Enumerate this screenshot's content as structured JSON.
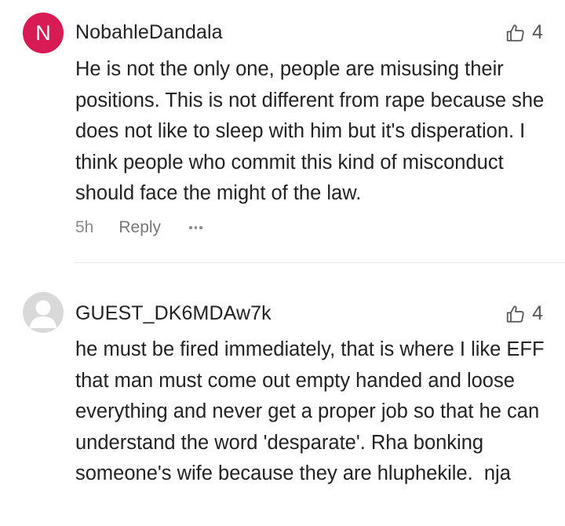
{
  "comments": [
    {
      "author": "NobahleDandala",
      "avatar_initial": "N",
      "avatar_color": "#d81b55",
      "likes": "4",
      "text": "He is not the only one, people are misusing their positions. This is not different from rape because she does not like to sleep with him but it's disperation. I think people who commit this kind of misconduct should face the might of the law.",
      "time": "5h",
      "reply_label": "Reply",
      "more_icon": "more-dots-icon"
    },
    {
      "author": "GUEST_DK6MDAw7k",
      "avatar_color": "#d9d9d9",
      "likes": "4",
      "text": "he must be fired immediately, that is where I like EFF that man must come out empty handed and loose everything and never get a proper job so that he can understand the word 'desparate'. Rha bonking someone's wife because they are hluphekile.  nja"
    }
  ],
  "icons": {
    "like": "thumbs-up-icon",
    "guest_avatar": "person-icon"
  }
}
